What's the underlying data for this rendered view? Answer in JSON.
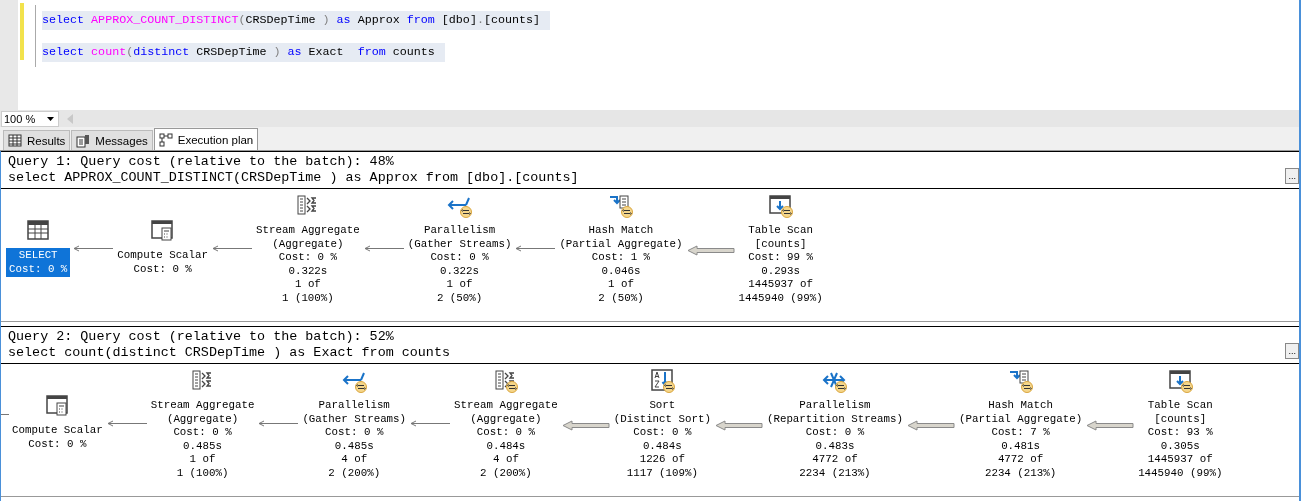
{
  "editor": {
    "lines": [
      {
        "tokens": [
          {
            "kind": "keyword",
            "text": "select "
          },
          {
            "kind": "function",
            "text": "APPROX_COUNT_DISTINCT"
          },
          {
            "kind": "punct",
            "text": "("
          },
          {
            "kind": "plain",
            "text": "CRSDepTime "
          },
          {
            "kind": "punct",
            "text": ") "
          },
          {
            "kind": "keyword",
            "text": "as"
          },
          {
            "kind": "plain",
            "text": " Approx "
          },
          {
            "kind": "keyword",
            "text": "from"
          },
          {
            "kind": "plain",
            "text": " [dbo]"
          },
          {
            "kind": "punct",
            "text": "."
          },
          {
            "kind": "plain",
            "text": "[counts]"
          }
        ]
      },
      {
        "tokens": [
          {
            "kind": "keyword",
            "text": "select "
          },
          {
            "kind": "function",
            "text": "count"
          },
          {
            "kind": "punct",
            "text": "("
          },
          {
            "kind": "keyword",
            "text": "distinct"
          },
          {
            "kind": "plain",
            "text": " CRSDepTime "
          },
          {
            "kind": "punct",
            "text": ") "
          },
          {
            "kind": "keyword",
            "text": "as"
          },
          {
            "kind": "plain",
            "text": " Exact  "
          },
          {
            "kind": "keyword",
            "text": "from"
          },
          {
            "kind": "plain",
            "text": " counts"
          }
        ]
      }
    ],
    "zoom": "100 %"
  },
  "tabs": [
    {
      "label": "Results",
      "selected": false
    },
    {
      "label": "Messages",
      "selected": false
    },
    {
      "label": "Execution plan",
      "selected": true
    }
  ],
  "queries": [
    {
      "header": "Query 1: Query cost (relative to the batch): 48%",
      "sql": "select APPROX_COUNT_DISTINCT(CRSDepTime ) as Approx from [dbo].[counts]",
      "more": "...",
      "nodes": [
        {
          "kind": "select",
          "parallel": false,
          "selected": true,
          "lines": [
            "SELECT",
            "Cost: 0 %"
          ]
        },
        {
          "kind": "compute",
          "parallel": false,
          "selected": false,
          "thick_arrow": false,
          "lines": [
            "Compute Scalar",
            "Cost: 0 %"
          ]
        },
        {
          "kind": "stream",
          "parallel": false,
          "selected": false,
          "thick_arrow": false,
          "lines": [
            "Stream Aggregate",
            "(Aggregate)",
            "Cost: 0 %",
            "0.322s",
            "1 of",
            "1 (100%)"
          ]
        },
        {
          "kind": "gather",
          "parallel": true,
          "selected": false,
          "thick_arrow": false,
          "lines": [
            "Parallelism",
            "(Gather Streams)",
            "Cost: 0 %",
            "0.322s",
            "1 of",
            "2 (50%)"
          ]
        },
        {
          "kind": "hash",
          "parallel": true,
          "selected": false,
          "thick_arrow": false,
          "lines": [
            "Hash Match",
            "(Partial Aggregate)",
            "Cost: 1 %",
            "0.046s",
            "1 of",
            "2 (50%)"
          ]
        },
        {
          "kind": "table",
          "parallel": true,
          "selected": false,
          "thick_arrow": true,
          "lines": [
            "Table Scan",
            "[counts]",
            "Cost: 99 %",
            "0.293s",
            "1445937 of",
            "1445940 (99%)"
          ]
        }
      ]
    },
    {
      "header": "Query 2: Query cost (relative to the batch): 52%",
      "sql": "select count(distinct CRSDepTime ) as Exact from counts",
      "more": "...",
      "lead_arrow": true,
      "nodes": [
        {
          "kind": "compute",
          "parallel": false,
          "selected": false,
          "lines": [
            "Compute Scalar",
            "Cost: 0 %"
          ]
        },
        {
          "kind": "stream",
          "parallel": false,
          "selected": false,
          "thick_arrow": false,
          "lines": [
            "Stream Aggregate",
            "(Aggregate)",
            "Cost: 0 %",
            "0.485s",
            "1 of",
            "1 (100%)"
          ]
        },
        {
          "kind": "gather",
          "parallel": true,
          "selected": false,
          "thick_arrow": false,
          "lines": [
            "Parallelism",
            "(Gather Streams)",
            "Cost: 0 %",
            "0.485s",
            "4 of",
            "2 (200%)"
          ]
        },
        {
          "kind": "stream",
          "parallel": true,
          "selected": false,
          "thick_arrow": false,
          "lines": [
            "Stream Aggregate",
            "(Aggregate)",
            "Cost: 0 %",
            "0.484s",
            "4 of",
            "2 (200%)"
          ]
        },
        {
          "kind": "sort",
          "parallel": true,
          "selected": false,
          "thick_arrow": true,
          "lines": [
            "Sort",
            "(Distinct Sort)",
            "Cost: 0 %",
            "0.484s",
            "1226 of",
            "1117 (109%)"
          ]
        },
        {
          "kind": "repartition",
          "parallel": true,
          "selected": false,
          "thick_arrow": true,
          "lines": [
            "Parallelism",
            "(Repartition Streams)",
            "Cost: 0 %",
            "0.483s",
            "4772 of",
            "2234 (213%)"
          ]
        },
        {
          "kind": "hash",
          "parallel": true,
          "selected": false,
          "thick_arrow": true,
          "lines": [
            "Hash Match",
            "(Partial Aggregate)",
            "Cost: 7 %",
            "0.481s",
            "4772 of",
            "2234 (213%)"
          ]
        },
        {
          "kind": "table",
          "parallel": true,
          "selected": false,
          "thick_arrow": true,
          "lines": [
            "Table Scan",
            "[counts]",
            "Cost: 93 %",
            "0.305s",
            "1445937 of",
            "1445940 (99%)"
          ]
        }
      ]
    }
  ]
}
